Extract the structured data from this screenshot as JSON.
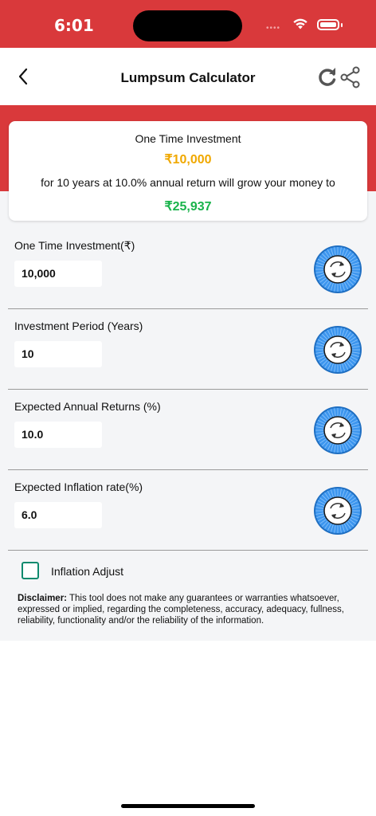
{
  "status_bar": {
    "time": "6:01",
    "signal_dots": "••••"
  },
  "header": {
    "title": "Lumpsum Calculator"
  },
  "summary": {
    "title": "One Time Investment",
    "amount": "₹10,000",
    "description": "for 10 years at 10.0% annual return will grow your money to",
    "result": "₹25,937"
  },
  "fields": [
    {
      "label": "One Time Investment(₹)",
      "value": "10,000"
    },
    {
      "label": "Investment Period (Years)",
      "value": "10"
    },
    {
      "label": "Expected Annual Returns (%)",
      "value": "10.0"
    },
    {
      "label": "Expected Inflation rate(%)",
      "value": "6.0"
    }
  ],
  "inflation_adjust": {
    "label": "Inflation Adjust",
    "checked": false
  },
  "disclaimer": {
    "heading": "Disclaimer:",
    "text": " This tool does not make any guarantees or warranties whatsoever, expressed or implied, regarding the completeness, accuracy, adequacy, fullness, reliability, functionality and/or the reliability of the information."
  },
  "colors": {
    "header_red": "#d9393b",
    "amount_yellow": "#f0a800",
    "result_green": "#19b34b",
    "dial_blue": "#2d8be8",
    "checkbox_teal": "#0f8a6e"
  },
  "icons": [
    "back-chevron-icon",
    "refresh-icon",
    "share-icon",
    "wifi-icon",
    "battery-icon",
    "dial-refresh-icon"
  ]
}
